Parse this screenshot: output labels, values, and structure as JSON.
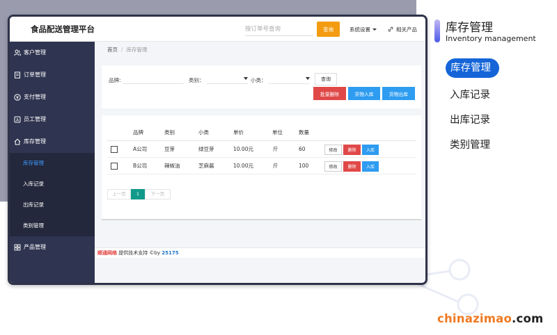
{
  "app": {
    "title": "食品配送管理平台",
    "search_placeholder": "按订单号查询",
    "query_label": "查询",
    "system_settings": "系统设置",
    "related_products": "相关产品"
  },
  "sidebar": {
    "items": [
      {
        "label": "客户管理",
        "icon": "users-icon"
      },
      {
        "label": "订单管理",
        "icon": "document-icon"
      },
      {
        "label": "支付管理",
        "icon": "payment-icon"
      },
      {
        "label": "员工管理",
        "icon": "id-card-icon"
      },
      {
        "label": "库存管理",
        "icon": "home-icon"
      }
    ],
    "submenu": [
      {
        "label": "库存管理",
        "active": true
      },
      {
        "label": "入库记录",
        "active": false
      },
      {
        "label": "出库记录",
        "active": false
      },
      {
        "label": "类别管理",
        "active": false
      }
    ],
    "last_item": {
      "label": "产品管理",
      "icon": "grid-icon"
    }
  },
  "breadcrumb": {
    "home": "首页",
    "separator": "/",
    "current": "库存管理"
  },
  "filters": {
    "brand_label": "品牌:",
    "category_label": "类别：",
    "subcategory_label": "小类：",
    "query_label": "查询",
    "batch_delete": "批量删除",
    "stock_in": "货物入库",
    "stock_out": "货物出库"
  },
  "table": {
    "headers": [
      "品牌",
      "类别",
      "小类",
      "单价",
      "单位",
      "数量"
    ],
    "rows": [
      {
        "brand": "A公司",
        "category": "豆芽",
        "subcategory": "绿豆芽",
        "price": "10.00元",
        "unit": "斤",
        "qty": "60"
      },
      {
        "brand": "B公司",
        "category": "辣椒油",
        "subcategory": "芝麻酱",
        "price": "10.00元",
        "unit": "斤",
        "qty": "100"
      }
    ],
    "actions": {
      "edit": "修改",
      "delete": "删除",
      "stock_in": "入库"
    }
  },
  "pager": {
    "prev": "上一页",
    "current": "1",
    "next": "下一页"
  },
  "footer": {
    "company": "顺通网络",
    "text": " 提供技术支持 ©by ",
    "id": "25175"
  },
  "right_panel": {
    "title": "库存管理",
    "subtitle": "Inventory management",
    "items": [
      "库存管理",
      "入库记录",
      "出库记录",
      "类别管理"
    ]
  },
  "watermark": {
    "part1": "chinazimao",
    "part2": ".com"
  },
  "colors": {
    "accent_blue": "#1565d8",
    "query_orange": "#f39c12",
    "danger_red": "#e04848",
    "info_blue": "#2e9cf0",
    "sidebar_bg": "#2f3450",
    "pager_teal": "#119a8a"
  }
}
